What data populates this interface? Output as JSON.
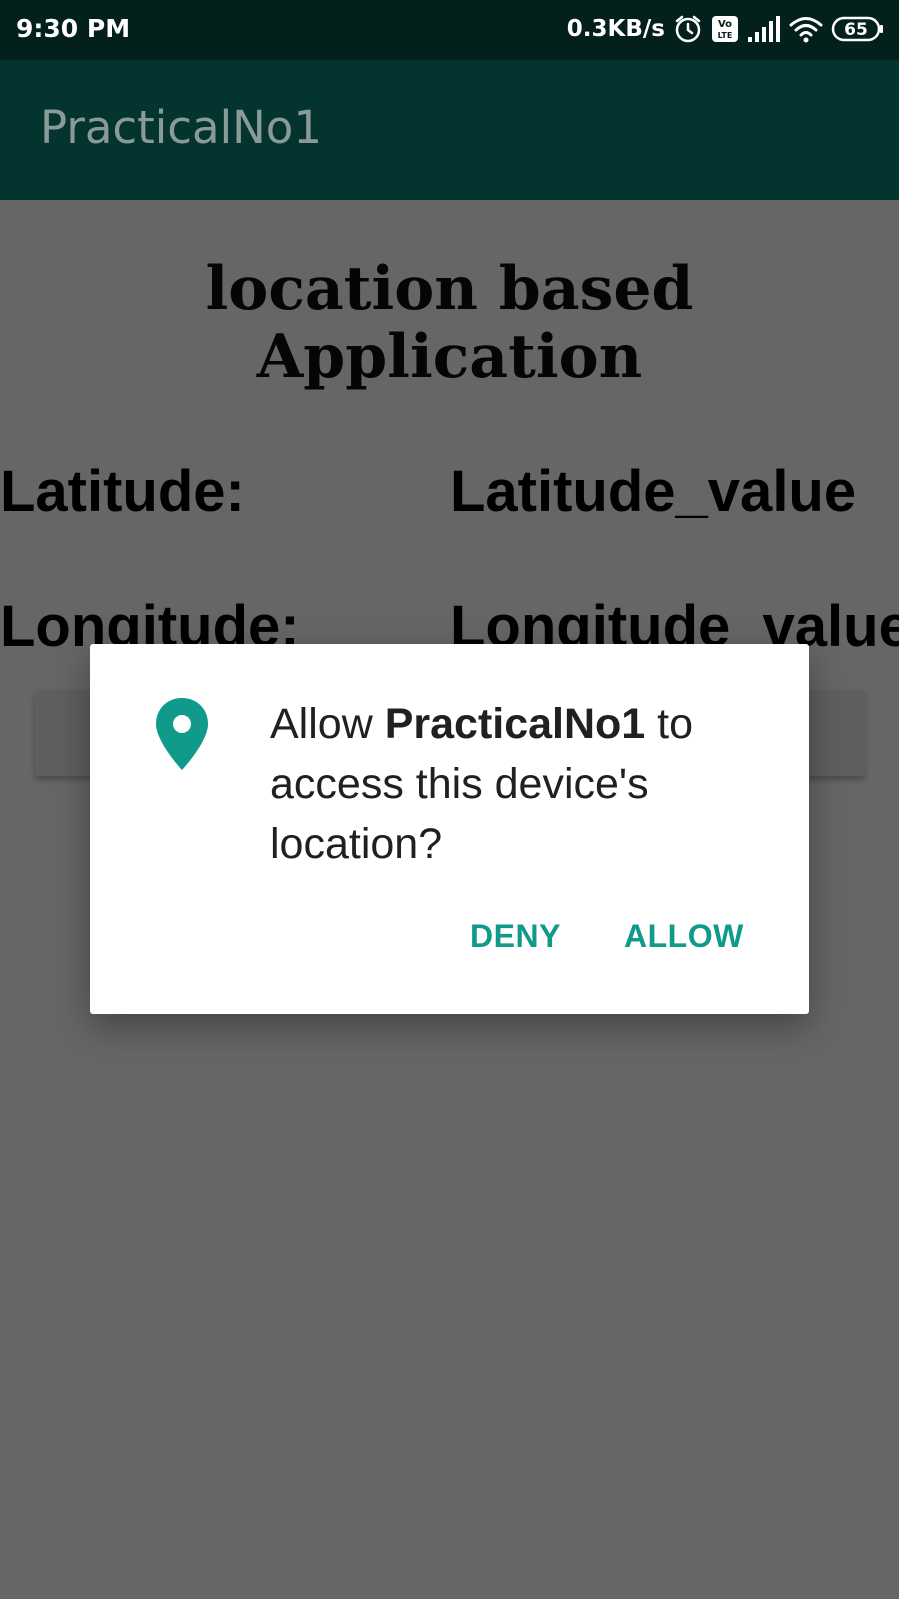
{
  "status_bar": {
    "time": "9:30 PM",
    "net_speed": "0.3KB/s",
    "battery": "65",
    "icons": [
      "alarm-icon",
      "volte-icon",
      "signal-icon",
      "wifi-icon",
      "battery-icon"
    ]
  },
  "app_bar": {
    "title": "PracticalNo1"
  },
  "content": {
    "heading": "location based Application",
    "latitude_label": "Latitude:",
    "latitude_value": "Latitude_value",
    "longitude_label": "Longitude:",
    "longitude_value": "Longitude_value"
  },
  "dialog": {
    "icon": "location-pin-icon",
    "message_prefix": "Allow ",
    "app_name": "PracticalNo1",
    "message_suffix": " to access this device's location?",
    "deny_label": "DENY",
    "allow_label": "ALLOW"
  },
  "colors": {
    "status_bar_bg": "#04201d",
    "app_bar_bg": "#04342f",
    "scrim": "#666666",
    "accent": "#0f9a8a"
  }
}
